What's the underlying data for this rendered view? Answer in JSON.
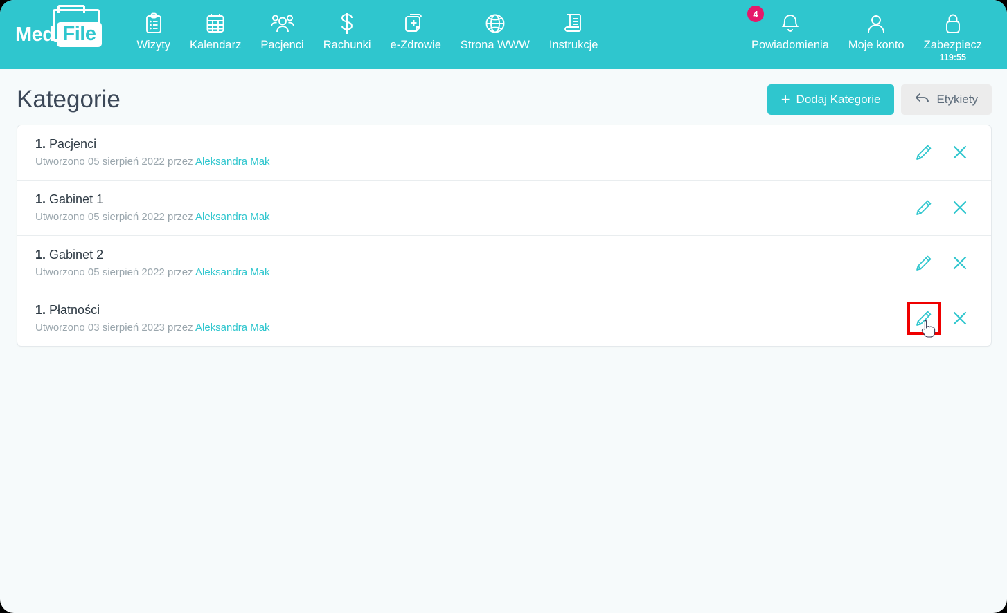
{
  "brand": {
    "word_one": "Med",
    "word_two": "File"
  },
  "colors": {
    "teal": "#2FC6CE",
    "badge_pink": "#E5196A",
    "title_gray": "#3C4858",
    "muted_gray": "#9AA6AD",
    "highlight_red": "#EF0000",
    "page_bg": "#F6FAFB",
    "secondary_btn_bg": "#ECECEC"
  },
  "topnav": {
    "items": [
      {
        "label": "Wizyty",
        "icon": "clipboard-icon"
      },
      {
        "label": "Kalendarz",
        "icon": "calendar-icon"
      },
      {
        "label": "Pacjenci",
        "icon": "people-icon"
      },
      {
        "label": "Rachunki",
        "icon": "dollar-icon"
      },
      {
        "label": "e-Zdrowie",
        "icon": "medical-file-icon"
      },
      {
        "label": "Strona WWW",
        "icon": "globe-icon"
      },
      {
        "label": "Instrukcje",
        "icon": "book-icon"
      }
    ],
    "right_items": [
      {
        "label": "Powiadomienia",
        "icon": "bell-icon",
        "badge": "4"
      },
      {
        "label": "Moje konto",
        "icon": "user-icon"
      },
      {
        "label": "Zabezpiecz",
        "icon": "lock-icon",
        "sub": "119:55"
      }
    ]
  },
  "page": {
    "title": "Kategorie",
    "add_button": "Dodaj Kategorie",
    "add_button_plus": "+",
    "labels_button": "Etykiety"
  },
  "categories": [
    {
      "index": "1.",
      "name": "Pacjenci",
      "created_prefix": "Utworzono",
      "date": "05 sierpień 2022",
      "by": "przez",
      "author": "Aleksandra Mak",
      "highlighted": false
    },
    {
      "index": "1.",
      "name": "Gabinet 1",
      "created_prefix": "Utworzono",
      "date": "05 sierpień 2022",
      "by": "przez",
      "author": "Aleksandra Mak",
      "highlighted": false
    },
    {
      "index": "1.",
      "name": "Gabinet 2",
      "created_prefix": "Utworzono",
      "date": "05 sierpień 2022",
      "by": "przez",
      "author": "Aleksandra Mak",
      "highlighted": false
    },
    {
      "index": "1.",
      "name": "Płatności",
      "created_prefix": "Utworzono",
      "date": "03 sierpień 2023",
      "by": "przez",
      "author": "Aleksandra Mak",
      "highlighted": true
    }
  ],
  "row_actions": {
    "edit_icon": "pencil-icon",
    "delete_icon": "close-x-icon"
  }
}
